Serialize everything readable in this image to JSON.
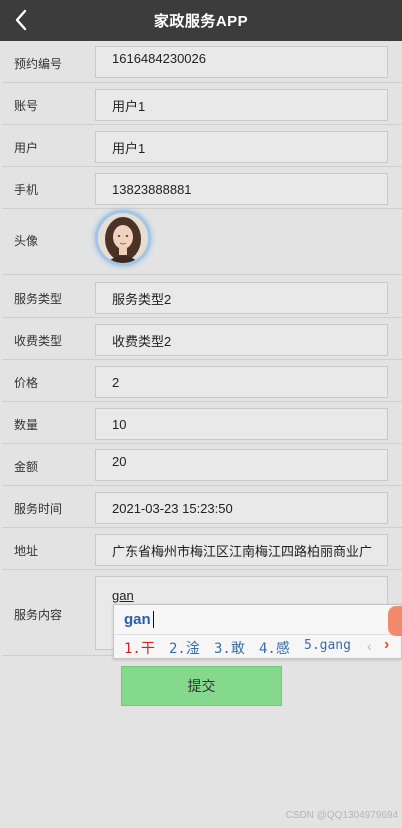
{
  "header": {
    "title": "家政服务APP",
    "back_icon": "chevron-left-icon"
  },
  "form": {
    "booking_no": {
      "label": "预约编号",
      "value": "1616484230026"
    },
    "account": {
      "label": "账号",
      "value": "用户1"
    },
    "user": {
      "label": "用户",
      "value": "用户1"
    },
    "phone": {
      "label": "手机",
      "value": "13823888881"
    },
    "avatar": {
      "label": "头像"
    },
    "service_type": {
      "label": "服务类型",
      "value": "服务类型2"
    },
    "fee_type": {
      "label": "收费类型",
      "value": "收费类型2"
    },
    "price": {
      "label": "价格",
      "value": "2"
    },
    "quantity": {
      "label": "数量",
      "value": "10"
    },
    "amount": {
      "label": "金额",
      "value": "20"
    },
    "service_time": {
      "label": "服务时间",
      "value": "2021-03-23 15:23:50"
    },
    "address": {
      "label": "地址",
      "value": "广东省梅州市梅江区江南梅江四路柏丽商业广"
    },
    "service_content": {
      "label": "服务内容",
      "value": "gan"
    }
  },
  "ime": {
    "composition": "gan",
    "candidates": [
      "1.干",
      "2.淦",
      "3.敢",
      "4.感",
      "5.gang"
    ],
    "prev_arrow": "‹",
    "next_arrow": "›"
  },
  "submit_label": "提交",
  "watermark": "CSDN @QQ1304979694",
  "colors": {
    "header_bg": "#3c3c3c",
    "submit_bg": "#84d98c",
    "page_bg": "#e3e3e3"
  }
}
